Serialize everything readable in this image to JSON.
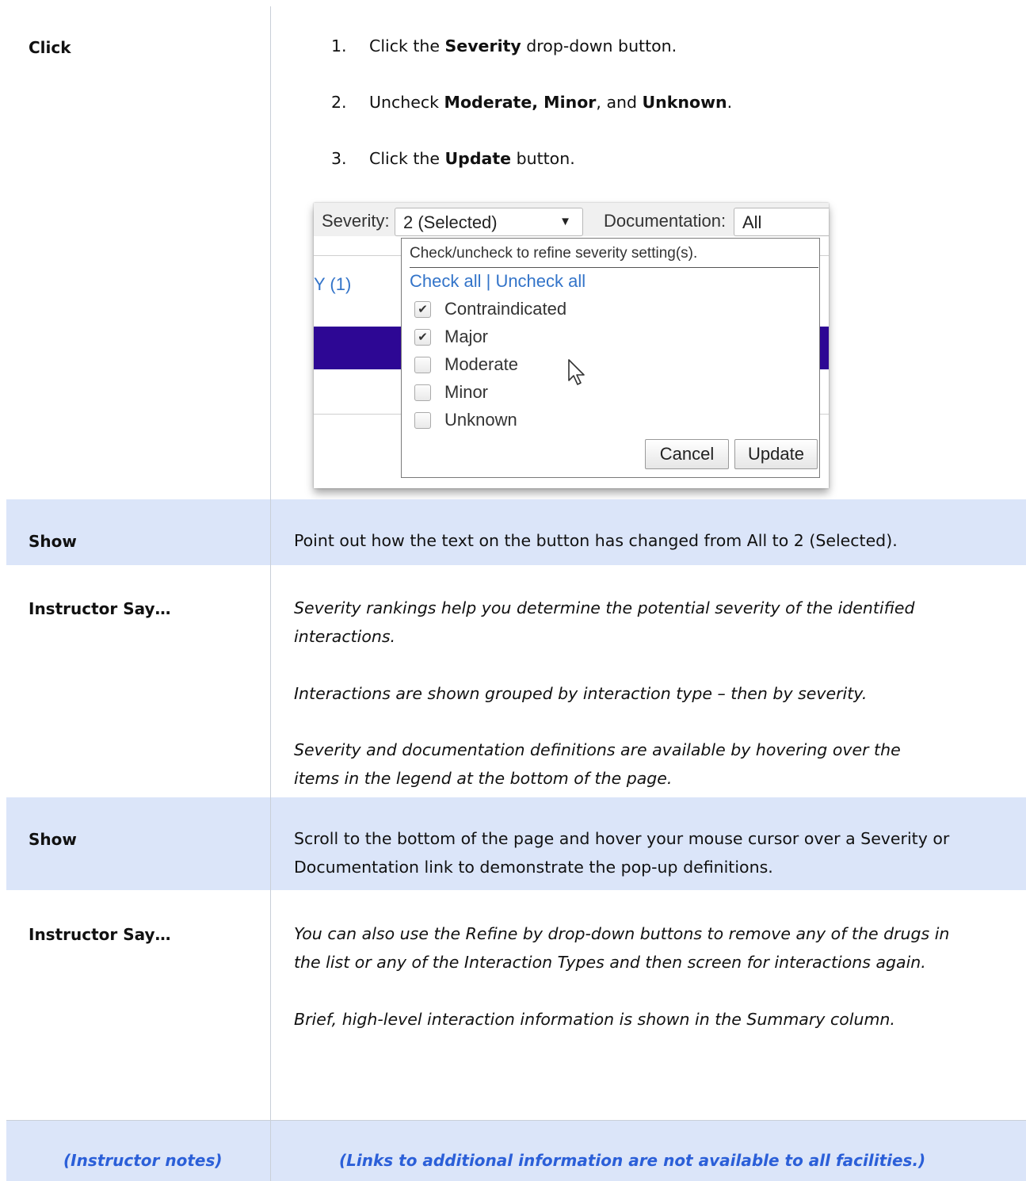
{
  "rows": {
    "click": {
      "label": "Click",
      "steps": [
        {
          "num": "1.",
          "pre": "Click the ",
          "bold": "Severity",
          "post": " drop-down button."
        },
        {
          "num": "2.",
          "pre": "Uncheck ",
          "bold": "Moderate, Minor",
          "mid": ", and ",
          "bold2": "Unknown",
          "post": "."
        },
        {
          "num": "3.",
          "pre": "Click the ",
          "bold": "Update",
          "post": " button."
        }
      ]
    },
    "show1": {
      "label": "Show",
      "text": "Point out how the text on the button has changed from All to 2 (Selected)."
    },
    "say1": {
      "label": "Instructor Say…",
      "p1a": "Severity rankings help you determine the potential severity of the identified",
      "p1b": "interactions.",
      "p2": "Interactions are shown grouped by interaction type – then by severity.",
      "p3a": "Severity and documentation definitions are available by hovering over the",
      "p3b": "items in the legend at the bottom of the page."
    },
    "show2": {
      "label": "Show",
      "line1": "Scroll to the bottom of the page and hover your mouse cursor over a Severity or",
      "line2": "Documentation link to demonstrate the pop-up definitions."
    },
    "say2": {
      "label": "Instructor Say…",
      "p1a": "You can also use the Refine by drop-down buttons to remove any of the drugs in",
      "p1b": "the list or any of the Interaction Types and then screen for interactions again.",
      "p2": "Brief, high-level interaction information is shown in the Summary column."
    },
    "notes": {
      "label": "(Instructor notes)",
      "text": "(Links to additional information are not available to all facilities.)"
    }
  },
  "screenshot": {
    "severity_label": "Severity:",
    "severity_value": "2 (Selected)",
    "documentation_label": "Documentation:",
    "documentation_value": "All",
    "background_link": "Y (1)",
    "hint": "Check/uncheck to refine severity setting(s).",
    "check_all": "Check all",
    "link_sep": " | ",
    "uncheck_all": "Uncheck all",
    "options": [
      {
        "label": "Contraindicated",
        "checked": true
      },
      {
        "label": "Major",
        "checked": true
      },
      {
        "label": "Moderate",
        "checked": false
      },
      {
        "label": "Minor",
        "checked": false
      },
      {
        "label": "Unknown",
        "checked": false
      }
    ],
    "cancel": "Cancel",
    "update": "Update",
    "purple_color": "#2d0794",
    "link_color": "#3374c9"
  },
  "colors": {
    "row_blue": "#dbe5f9",
    "notes_blue": "#2b5fd8"
  }
}
